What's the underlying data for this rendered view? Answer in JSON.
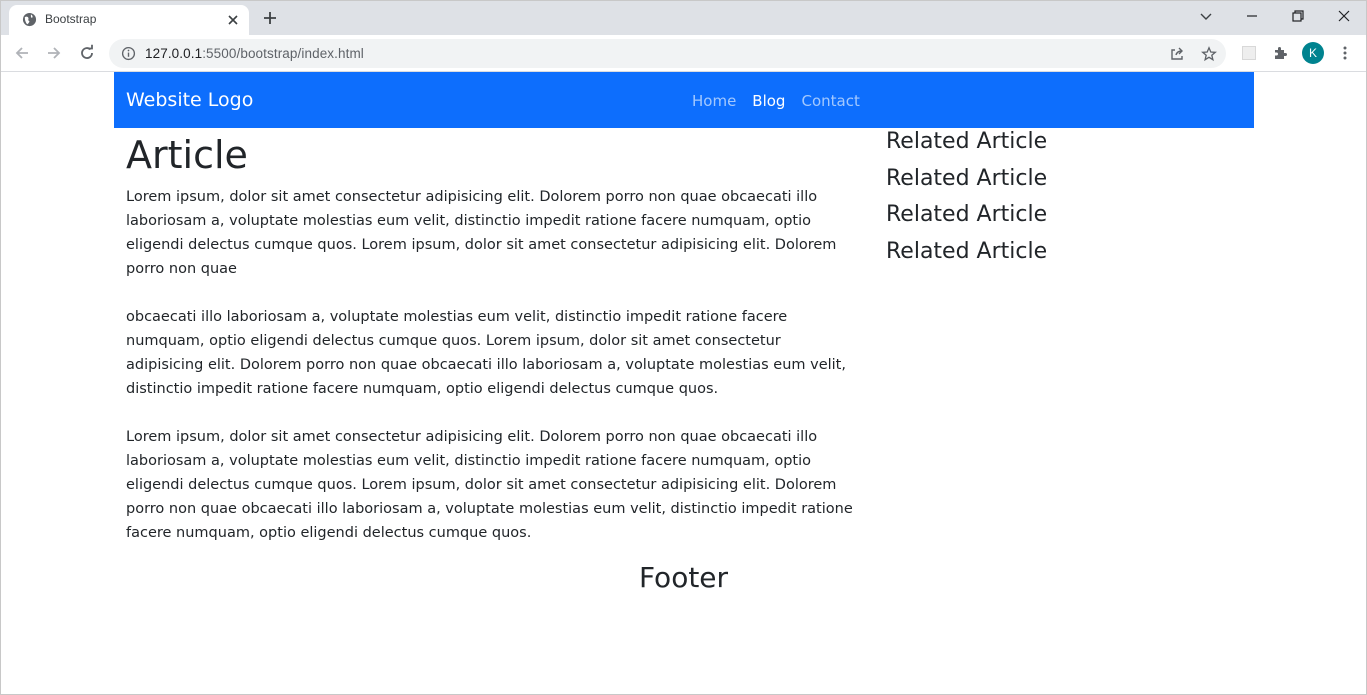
{
  "browser": {
    "tab_title": "Bootstrap",
    "url_host": "127.0.0.1",
    "url_rest": ":5500/bootstrap/index.html",
    "profile_initial": "K",
    "profile_color": "#00838f"
  },
  "navbar": {
    "brand": "Website Logo",
    "color": "#0d6efd",
    "links": [
      {
        "label": "Home",
        "active": false
      },
      {
        "label": "Blog",
        "active": true
      },
      {
        "label": "Contact",
        "active": false
      }
    ]
  },
  "article": {
    "title": "Article",
    "paragraphs": [
      "Lorem ipsum, dolor sit amet consectetur adipisicing elit. Dolorem porro non quae obcaecati illo laboriosam a, voluptate molestias eum velit, distinctio impedit ratione facere numquam, optio eligendi delectus cumque quos. Lorem ipsum, dolor sit amet consectetur adipisicing elit. Dolorem porro non quae",
      "obcaecati illo laboriosam a, voluptate molestias eum velit, distinctio impedit ratione facere numquam, optio eligendi delectus cumque quos. Lorem ipsum, dolor sit amet consectetur adipisicing elit. Dolorem porro non quae obcaecati illo laboriosam a, voluptate molestias eum velit, distinctio impedit ratione facere numquam, optio eligendi delectus cumque quos.",
      "Lorem ipsum, dolor sit amet consectetur adipisicing elit. Dolorem porro non quae obcaecati illo laboriosam a, voluptate molestias eum velit, distinctio impedit ratione facere numquam, optio eligendi delectus cumque quos. Lorem ipsum, dolor sit amet consectetur adipisicing elit. Dolorem porro non quae obcaecati illo laboriosam a, voluptate molestias eum velit, distinctio impedit ratione facere numquam, optio eligendi delectus cumque quos."
    ]
  },
  "sidebar": {
    "items": [
      "Related Article",
      "Related Article",
      "Related Article",
      "Related Article"
    ]
  },
  "footer": {
    "text": "Footer"
  }
}
